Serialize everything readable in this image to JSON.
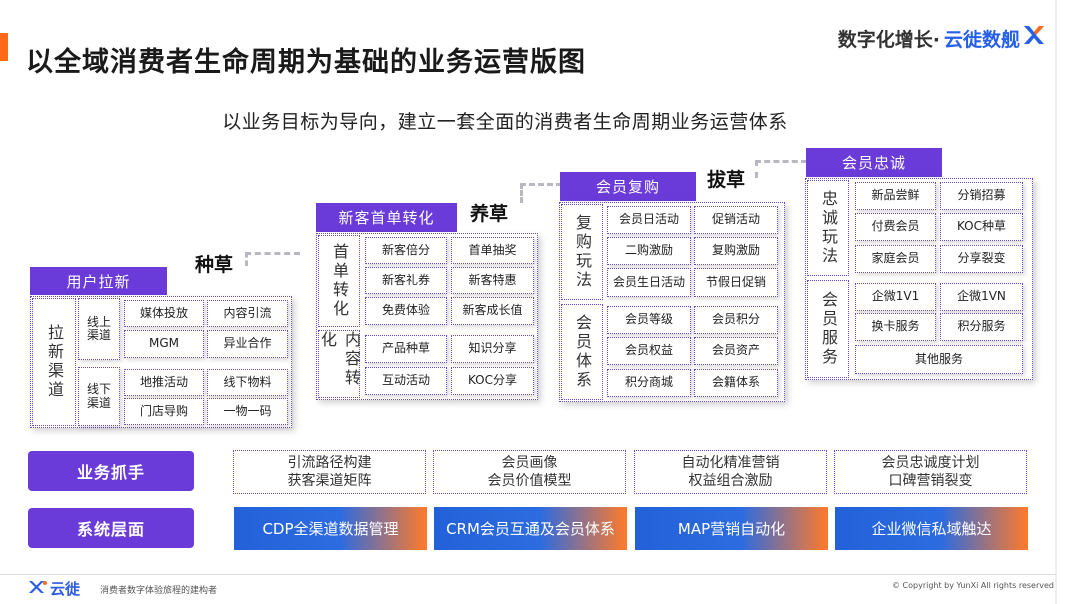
{
  "header": {
    "title": "以全域消费者生命周期为基础的业务运营版图",
    "brand_left": "数字化增长·",
    "brand_right": "云徙数舰",
    "brand_mark": "X"
  },
  "subtitle": "以业务目标为导向，建立一套全面的消费者生命周期业务运营体系",
  "stages": {
    "s1": "种草",
    "s2": "养草",
    "s3": "拔草"
  },
  "panels": {
    "acquire": {
      "header": "用户拉新",
      "side": "拉新渠道",
      "online": "线上渠道",
      "offline": "线下渠道",
      "cells": [
        "媒体投放",
        "内容引流",
        "MGM",
        "异业合作",
        "地推活动",
        "线下物料",
        "门店导购",
        "一物一码"
      ]
    },
    "firstorder": {
      "header": "新客首单转化",
      "side1": "首单转化",
      "side2": "内容转化",
      "cells": [
        "新客倍分",
        "首单抽奖",
        "新客礼券",
        "新客特惠",
        "免费体验",
        "新客成长值",
        "产品种草",
        "知识分享",
        "互动活动",
        "KOC分享"
      ]
    },
    "repurchase": {
      "header": "会员复购",
      "side1": "复购玩法",
      "side2": "会员体系",
      "cells": [
        "会员日活动",
        "促销活动",
        "二购激励",
        "复购激励",
        "会员生日活动",
        "节假日促销",
        "会员等级",
        "会员积分",
        "会员权益",
        "会员资产",
        "积分商城",
        "会籍体系"
      ]
    },
    "loyalty": {
      "header": "会员忠诚",
      "side1": "忠诚玩法",
      "side2": "会员服务",
      "cells": [
        "新品尝鲜",
        "分销招募",
        "付费会员",
        "KOC种草",
        "家庭会员",
        "分享裂变",
        "企微1V1",
        "企微1VN",
        "换卡服务",
        "积分服务",
        "其他服务"
      ]
    }
  },
  "business": {
    "label": "业务抓手",
    "boxes": [
      [
        "引流路径构建",
        "获客渠道矩阵"
      ],
      [
        "会员画像",
        "会员价值模型"
      ],
      [
        "自动化精准营销",
        "权益组合激励"
      ],
      [
        "会员忠诚度计划",
        "口碑营销裂变"
      ]
    ]
  },
  "system": {
    "label": "系统层面",
    "boxes": [
      "CDP全渠道数据管理",
      "CRM会员互通及会员体系",
      "MAP营销自动化",
      "企业微信私域触达"
    ]
  },
  "footer": {
    "logo": "云徙",
    "tagline": "消费者数字体验旅程的建构者",
    "copyright": "© Copyright by YunXi All rights reserved"
  },
  "colors": {
    "accent": "#ff6a1a",
    "purple": "#6a3bd8",
    "blue": "#2261d8"
  }
}
